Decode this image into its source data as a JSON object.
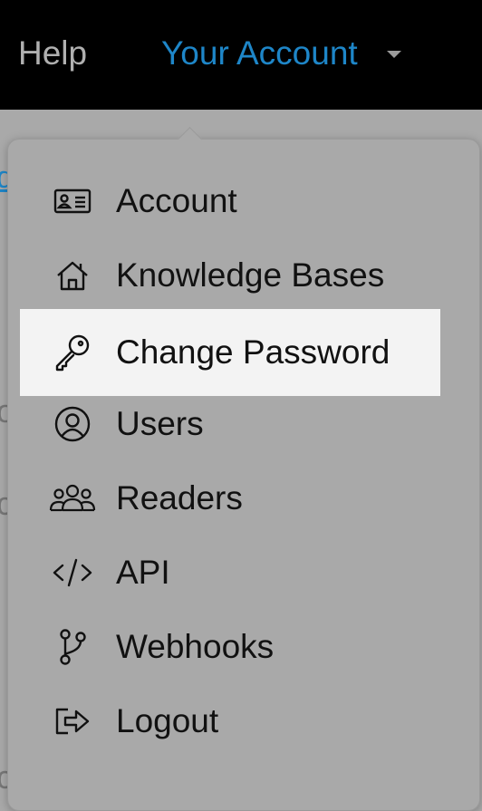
{
  "nav": {
    "help_label": "Help",
    "account_label": "Your Account"
  },
  "background_fragments": {
    "link_char": "d",
    "char1": "o",
    "char2": "c",
    "char3": "c"
  },
  "dropdown": {
    "items": [
      {
        "label": "Account",
        "icon": "id-card-icon",
        "active": false
      },
      {
        "label": "Knowledge Bases",
        "icon": "house-icon",
        "active": false
      },
      {
        "label": "Change Password",
        "icon": "key-icon",
        "active": true
      },
      {
        "label": "Users",
        "icon": "user-circle-icon",
        "active": false
      },
      {
        "label": "Readers",
        "icon": "people-icon",
        "active": false
      },
      {
        "label": "API",
        "icon": "code-icon",
        "active": false
      },
      {
        "label": "Webhooks",
        "icon": "branch-icon",
        "active": false
      },
      {
        "label": "Logout",
        "icon": "logout-icon",
        "active": false
      }
    ]
  },
  "colors": {
    "topbar": "#000000",
    "accent": "#1e86c8",
    "overlay": "#a9a9a9",
    "active_item": "#f3f3f3"
  }
}
